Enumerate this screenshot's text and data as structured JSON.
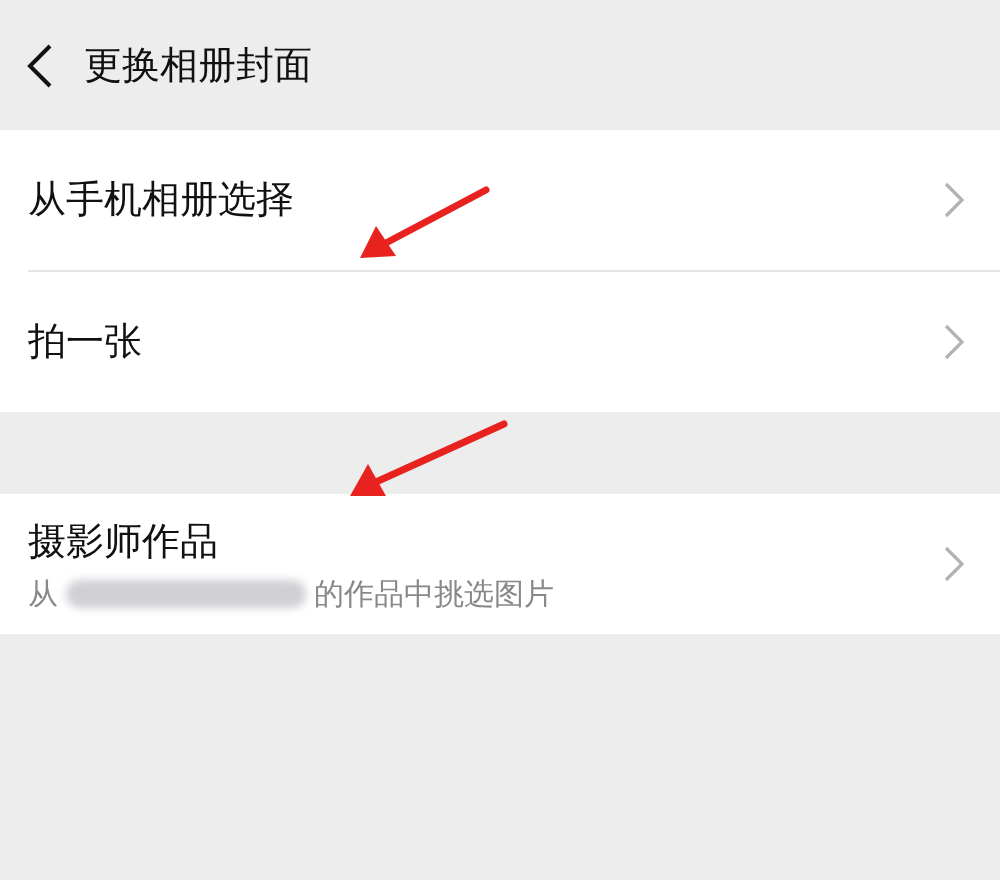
{
  "header": {
    "title": "更换相册封面"
  },
  "sections": [
    {
      "rows": [
        {
          "title": "从手机相册选择"
        },
        {
          "title": "拍一张"
        }
      ]
    },
    {
      "rows": [
        {
          "title": "摄影师作品",
          "subtitle_before": "从",
          "subtitle_after": "的作品中挑选图片"
        }
      ]
    }
  ]
}
